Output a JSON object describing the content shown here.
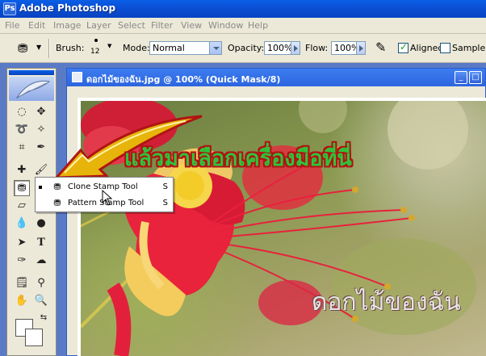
{
  "app": {
    "title": "Adobe Photoshop",
    "icon": "Ps"
  },
  "menu": [
    "File",
    "Edit",
    "Image",
    "Layer",
    "Select",
    "Filter",
    "View",
    "Window",
    "Help"
  ],
  "options": {
    "brush_label": "Brush:",
    "brush_size": "12",
    "mode_label": "Mode:",
    "mode_value": "Normal",
    "opacity_label": "Opacity:",
    "opacity_value": "100%",
    "flow_label": "Flow:",
    "flow_value": "100%",
    "aligned_label": "Aligned",
    "aligned_checked": true,
    "sample_label": "Sample A"
  },
  "document": {
    "title": "ดอกไม้ของฉัน.jpg @ 100% (Quick Mask/8)"
  },
  "flyout": {
    "items": [
      {
        "label": "Clone Stamp Tool",
        "key": "S"
      },
      {
        "label": "Pattern Stamp Tool",
        "key": "S"
      }
    ]
  },
  "annotation": {
    "headline": "แล้วมาเลือกเครื่องมือที่นี่",
    "watermark": "ดอกไม้ของฉัน"
  },
  "colors": {
    "title_bar": "#0b4fd4",
    "doc_title": "#2c65df",
    "arrow": "#e6b40a",
    "annotation_text": "#2ec43a",
    "annotation_outline": "#b01414"
  }
}
